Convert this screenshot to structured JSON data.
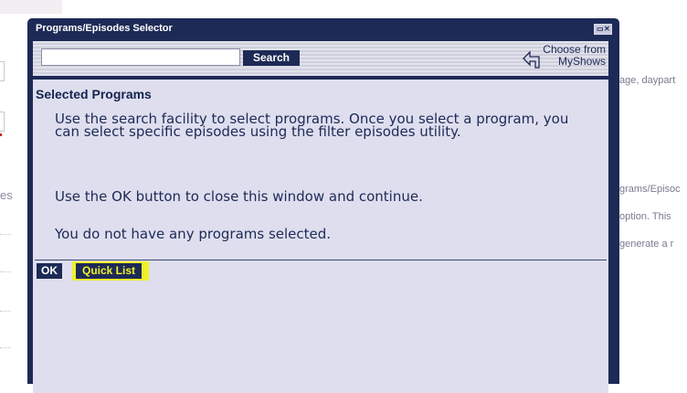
{
  "background_page": {
    "left_text": "es",
    "right_lines": [
      "age, daypart",
      "grams/Episoc",
      "option. This",
      "generate a r"
    ]
  },
  "dialog": {
    "title": "Programs/Episodes Selector",
    "search": {
      "value": "",
      "placeholder": "",
      "button_label": "Search"
    },
    "myshows": {
      "line1": "Choose from",
      "line2": "MyShows",
      "icon": "arrow-back-icon"
    },
    "section_title": "Selected Programs",
    "paragraphs": [
      "Use the search facility to select programs. Once you select a program, you can select specific episodes using the filter episodes utility.",
      "Use the OK button to close this window and continue.",
      "You do not have any programs selected."
    ],
    "buttons": {
      "ok": "OK",
      "quick_list": "Quick List"
    },
    "colors": {
      "navy": "#1d2a56",
      "panel": "#dedeee",
      "highlight": "#f0f02a"
    }
  }
}
